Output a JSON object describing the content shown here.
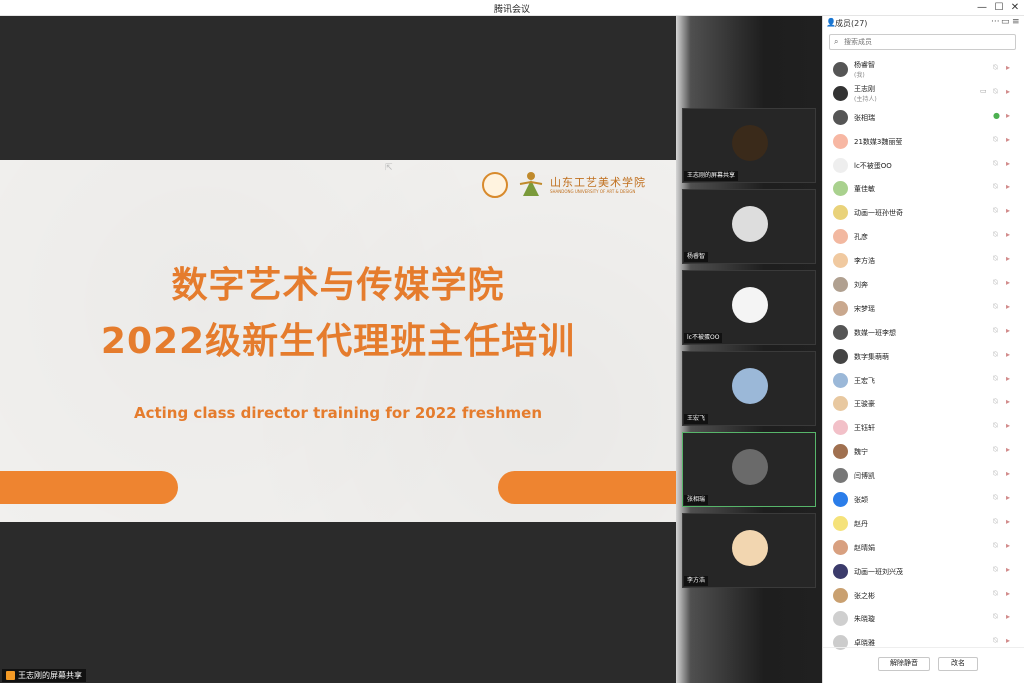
{
  "window": {
    "title": "腾讯会议"
  },
  "slide": {
    "school_name": "山东工艺美术学院",
    "school_name_en": "SHANDONG UNIVERSITY OF ART & DESIGN",
    "title_line1": "数字艺术与传媒学院",
    "title_line2": "2022级新生代理班主任培训",
    "subtitle_en": "Acting class director training for 2022 freshmen"
  },
  "share_label": "王志刚的屏幕共享",
  "gallery": [
    {
      "name": "王志刚的屏幕共享",
      "color": "#3a2a1a"
    },
    {
      "name": "杨睿智",
      "color": "#ddd"
    },
    {
      "name": "lc不被蛋OO",
      "color": "#f4f4f4"
    },
    {
      "name": "王宏飞",
      "color": "#9bb8d8"
    },
    {
      "name": "张相瑞",
      "color": "#6a6a6a"
    },
    {
      "name": "李方浩",
      "color": "#f2d6b0"
    }
  ],
  "panel": {
    "title": "成员(27)",
    "search_placeholder": "搜索成员",
    "members": [
      {
        "name": "杨睿智",
        "role": "(我)",
        "color": "#555"
      },
      {
        "name": "王志刚",
        "role": "(主持人)",
        "color": "#333"
      },
      {
        "name": "张相瑞",
        "color": "#555"
      },
      {
        "name": "21数媒3魏丽莹",
        "color": "#f7b7a3"
      },
      {
        "name": "lc不被蛋OO",
        "color": "#eee"
      },
      {
        "name": "董佳敏",
        "color": "#a9d18e"
      },
      {
        "name": "动画一班孙世奇",
        "color": "#e9d27a"
      },
      {
        "name": "孔彦",
        "color": "#f2b8a0"
      },
      {
        "name": "李方浩",
        "color": "#f0c9a0"
      },
      {
        "name": "刘奔",
        "color": "#b0a090"
      },
      {
        "name": "宋梦瑶",
        "color": "#c9a88e"
      },
      {
        "name": "数媒一班李想",
        "color": "#555"
      },
      {
        "name": "数字集萌萌",
        "color": "#444"
      },
      {
        "name": "王宏飞",
        "color": "#9bb8d8"
      },
      {
        "name": "王骏豪",
        "color": "#e8c8a0"
      },
      {
        "name": "王钰轩",
        "color": "#f2c0c8"
      },
      {
        "name": "魏宁",
        "color": "#a07050"
      },
      {
        "name": "闫博凯",
        "color": "#777"
      },
      {
        "name": "张颉",
        "color": "#2b7de9",
        "badge": "张颉"
      },
      {
        "name": "赵丹",
        "color": "#f5e27a"
      },
      {
        "name": "赵晴娟",
        "color": "#d8a080"
      },
      {
        "name": "动画一班刘兴茂",
        "color": "#3b3b6b"
      },
      {
        "name": "张之彬",
        "color": "#c9a070"
      },
      {
        "name": "朱晓璇",
        "color": "#cfcfcf"
      },
      {
        "name": "卓晓雅",
        "color": "#ccc"
      }
    ],
    "unmute_all": "解除静音",
    "rename": "改名"
  }
}
